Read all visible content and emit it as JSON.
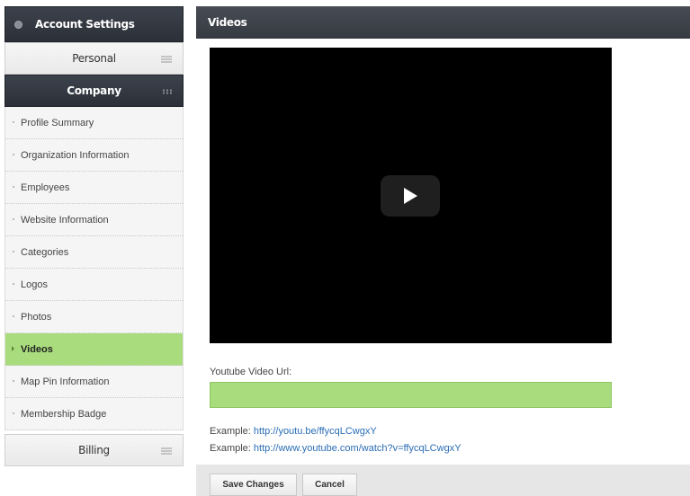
{
  "sidebar": {
    "title": "Account Settings",
    "sections": {
      "personal": "Personal",
      "company": "Company",
      "billing": "Billing"
    },
    "items": [
      {
        "label": "Profile Summary"
      },
      {
        "label": "Organization Information"
      },
      {
        "label": "Employees"
      },
      {
        "label": "Website Information"
      },
      {
        "label": "Categories"
      },
      {
        "label": "Logos"
      },
      {
        "label": "Photos"
      },
      {
        "label": "Videos",
        "active": true
      },
      {
        "label": "Map Pin Information"
      },
      {
        "label": "Membership Badge"
      }
    ]
  },
  "main": {
    "title": "Videos",
    "url_label": "Youtube Video Url:",
    "url_value": "",
    "examples": [
      {
        "prefix": "Example: ",
        "link": "http://youtu.be/ffycqLCwgxY"
      },
      {
        "prefix": "Example: ",
        "link": "http://www.youtube.com/watch?v=ffycqLCwgxY"
      }
    ],
    "save_label": "Save Changes",
    "cancel_label": "Cancel"
  },
  "colors": {
    "active_green": "#a9dc7d",
    "header_dark": "#363a41",
    "link_blue": "#2a6db5"
  }
}
